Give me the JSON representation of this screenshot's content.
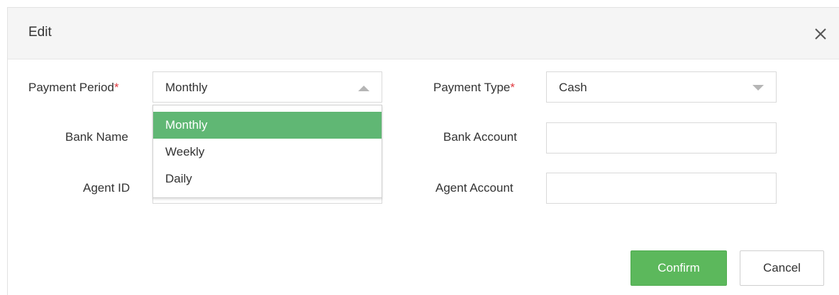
{
  "dialog": {
    "title": "Edit",
    "close_icon": "close-icon"
  },
  "form": {
    "payment_period": {
      "label": "Payment Period",
      "required_mark": "*",
      "value": "Monthly"
    },
    "payment_type": {
      "label": "Payment Type",
      "required_mark": "*",
      "value": "Cash"
    },
    "bank_name": {
      "label": "Bank Name",
      "value": ""
    },
    "bank_account": {
      "label": "Bank Account",
      "value": ""
    },
    "agent_id": {
      "label": "Agent ID",
      "value": ""
    },
    "agent_account": {
      "label": "Agent Account",
      "value": ""
    }
  },
  "dropdown": {
    "options": [
      "Monthly",
      "Weekly",
      "Daily"
    ],
    "selected": "Monthly",
    "highlight_color": "#60b774"
  },
  "buttons": {
    "confirm": "Confirm",
    "cancel": "Cancel"
  },
  "colors": {
    "accent": "#5cb85c",
    "required": "#e0383e",
    "header_bg": "#f5f5f5"
  }
}
